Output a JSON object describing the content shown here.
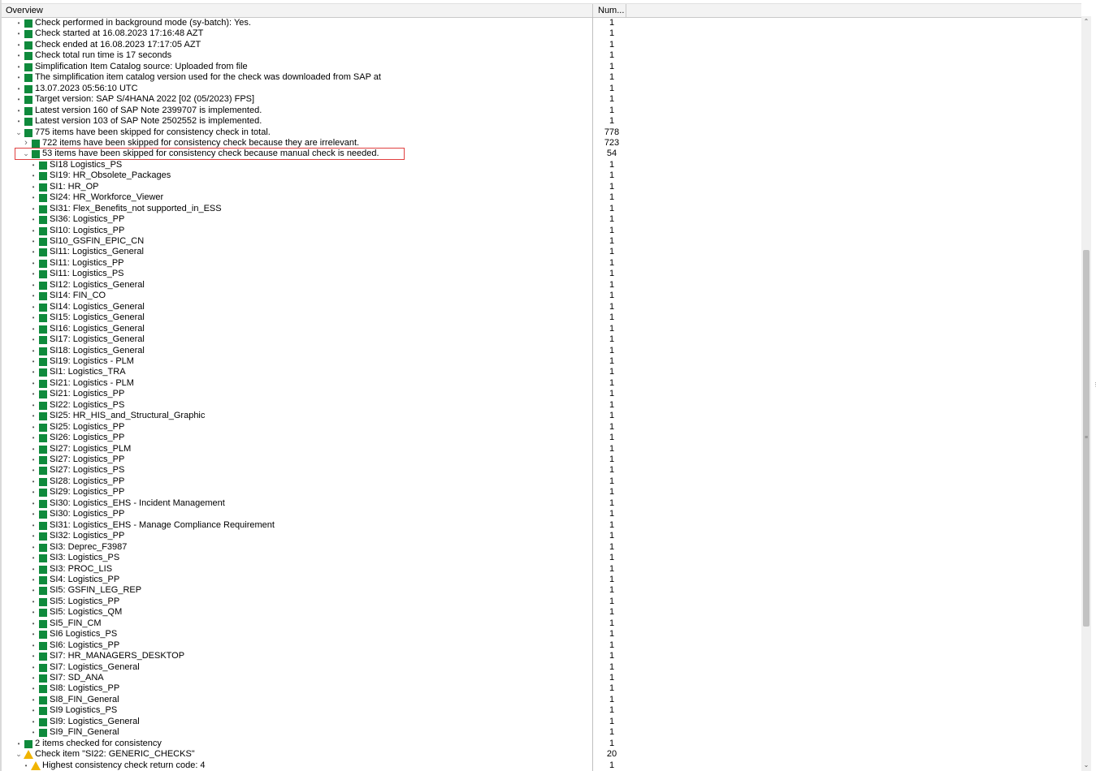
{
  "header": {
    "col_overview": "Overview",
    "col_num": "Num..."
  },
  "colors": {
    "status_ok": "#0f8a3c",
    "status_warning": "#f0b400",
    "highlight_border": "#e04040"
  },
  "rows": [
    {
      "level": 0,
      "toggle": "leaf",
      "icon": "green-square",
      "text": "Check performed in background mode (sy-batch): Yes.",
      "num": "1"
    },
    {
      "level": 0,
      "toggle": "leaf",
      "icon": "green-square",
      "text": "Check started at 16.08.2023 17:16:48 AZT",
      "num": "1"
    },
    {
      "level": 0,
      "toggle": "leaf",
      "icon": "green-square",
      "text": "Check ended at 16.08.2023 17:17:05 AZT",
      "num": "1"
    },
    {
      "level": 0,
      "toggle": "leaf",
      "icon": "green-square",
      "text": "Check total run time is 17  seconds",
      "num": "1"
    },
    {
      "level": 0,
      "toggle": "leaf",
      "icon": "green-square",
      "text": "Simplification Item Catalog source: Uploaded from file",
      "num": "1"
    },
    {
      "level": 0,
      "toggle": "leaf",
      "icon": "green-square",
      "text": "The simplification item catalog version used for the check was downloaded from SAP at",
      "num": "1"
    },
    {
      "level": 0,
      "toggle": "leaf",
      "icon": "green-square",
      "text": "13.07.2023 05:56:10 UTC",
      "num": "1"
    },
    {
      "level": 0,
      "toggle": "leaf",
      "icon": "green-square",
      "text": "Target version: SAP S/4HANA 2022 [02 (05/2023) FPS]",
      "num": "1"
    },
    {
      "level": 0,
      "toggle": "leaf",
      "icon": "green-square",
      "text": "Latest version 160 of SAP Note 2399707 is implemented.",
      "num": "1"
    },
    {
      "level": 0,
      "toggle": "leaf",
      "icon": "green-square",
      "text": "Latest version 103 of SAP Note 2502552 is implemented.",
      "num": "1"
    },
    {
      "level": 0,
      "toggle": "expanded",
      "icon": "green-square",
      "text": "775  items have been skipped for consistency check in total.",
      "num": "778"
    },
    {
      "level": 1,
      "toggle": "collapsed",
      "icon": "green-square",
      "text": "722  items have been skipped for consistency check because they are irrelevant.",
      "num": "723"
    },
    {
      "level": 1,
      "toggle": "expanded",
      "icon": "green-square",
      "text": "53  items have been skipped for consistency check because manual check is needed.",
      "num": "54"
    },
    {
      "level": 2,
      "toggle": "leaf",
      "icon": "green-square",
      "text": "SI18 Logistics_PS",
      "num": "1"
    },
    {
      "level": 2,
      "toggle": "leaf",
      "icon": "green-square",
      "text": "SI19: HR_Obsolete_Packages",
      "num": "1"
    },
    {
      "level": 2,
      "toggle": "leaf",
      "icon": "green-square",
      "text": "SI1: HR_OP",
      "num": "1"
    },
    {
      "level": 2,
      "toggle": "leaf",
      "icon": "green-square",
      "text": "SI24: HR_Workforce_Viewer",
      "num": "1"
    },
    {
      "level": 2,
      "toggle": "leaf",
      "icon": "green-square",
      "text": "SI31: Flex_Benefits_not supported_in_ESS",
      "num": "1"
    },
    {
      "level": 2,
      "toggle": "leaf",
      "icon": "green-square",
      "text": "SI36: Logistics_PP",
      "num": "1"
    },
    {
      "level": 2,
      "toggle": "leaf",
      "icon": "green-square",
      "text": "SI10: Logistics_PP",
      "num": "1"
    },
    {
      "level": 2,
      "toggle": "leaf",
      "icon": "green-square",
      "text": "SI10_GSFIN_EPIC_CN",
      "num": "1"
    },
    {
      "level": 2,
      "toggle": "leaf",
      "icon": "green-square",
      "text": "SI11: Logistics_General",
      "num": "1"
    },
    {
      "level": 2,
      "toggle": "leaf",
      "icon": "green-square",
      "text": "SI11: Logistics_PP",
      "num": "1"
    },
    {
      "level": 2,
      "toggle": "leaf",
      "icon": "green-square",
      "text": "SI11: Logistics_PS",
      "num": "1"
    },
    {
      "level": 2,
      "toggle": "leaf",
      "icon": "green-square",
      "text": "SI12: Logistics_General",
      "num": "1"
    },
    {
      "level": 2,
      "toggle": "leaf",
      "icon": "green-square",
      "text": "SI14: FIN_CO",
      "num": "1"
    },
    {
      "level": 2,
      "toggle": "leaf",
      "icon": "green-square",
      "text": "SI14: Logistics_General",
      "num": "1"
    },
    {
      "level": 2,
      "toggle": "leaf",
      "icon": "green-square",
      "text": "SI15: Logistics_General",
      "num": "1"
    },
    {
      "level": 2,
      "toggle": "leaf",
      "icon": "green-square",
      "text": "SI16: Logistics_General",
      "num": "1"
    },
    {
      "level": 2,
      "toggle": "leaf",
      "icon": "green-square",
      "text": "SI17: Logistics_General",
      "num": "1"
    },
    {
      "level": 2,
      "toggle": "leaf",
      "icon": "green-square",
      "text": "SI18: Logistics_General",
      "num": "1"
    },
    {
      "level": 2,
      "toggle": "leaf",
      "icon": "green-square",
      "text": "SI19: Logistics - PLM",
      "num": "1"
    },
    {
      "level": 2,
      "toggle": "leaf",
      "icon": "green-square",
      "text": "SI1: Logistics_TRA",
      "num": "1"
    },
    {
      "level": 2,
      "toggle": "leaf",
      "icon": "green-square",
      "text": "SI21: Logistics - PLM",
      "num": "1"
    },
    {
      "level": 2,
      "toggle": "leaf",
      "icon": "green-square",
      "text": "SI21: Logistics_PP",
      "num": "1"
    },
    {
      "level": 2,
      "toggle": "leaf",
      "icon": "green-square",
      "text": "SI22: Logistics_PS",
      "num": "1"
    },
    {
      "level": 2,
      "toggle": "leaf",
      "icon": "green-square",
      "text": "SI25: HR_HIS_and_Structural_Graphic",
      "num": "1"
    },
    {
      "level": 2,
      "toggle": "leaf",
      "icon": "green-square",
      "text": "SI25: Logistics_PP",
      "num": "1"
    },
    {
      "level": 2,
      "toggle": "leaf",
      "icon": "green-square",
      "text": "SI26: Logistics_PP",
      "num": "1"
    },
    {
      "level": 2,
      "toggle": "leaf",
      "icon": "green-square",
      "text": "SI27: Logistics_PLM",
      "num": "1"
    },
    {
      "level": 2,
      "toggle": "leaf",
      "icon": "green-square",
      "text": "SI27: Logistics_PP",
      "num": "1"
    },
    {
      "level": 2,
      "toggle": "leaf",
      "icon": "green-square",
      "text": "SI27: Logistics_PS",
      "num": "1"
    },
    {
      "level": 2,
      "toggle": "leaf",
      "icon": "green-square",
      "text": "SI28: Logistics_PP",
      "num": "1"
    },
    {
      "level": 2,
      "toggle": "leaf",
      "icon": "green-square",
      "text": "SI29: Logistics_PP",
      "num": "1"
    },
    {
      "level": 2,
      "toggle": "leaf",
      "icon": "green-square",
      "text": "SI30: Logistics_EHS - Incident Management",
      "num": "1"
    },
    {
      "level": 2,
      "toggle": "leaf",
      "icon": "green-square",
      "text": "SI30: Logistics_PP",
      "num": "1"
    },
    {
      "level": 2,
      "toggle": "leaf",
      "icon": "green-square",
      "text": "SI31: Logistics_EHS - Manage Compliance Requirement",
      "num": "1"
    },
    {
      "level": 2,
      "toggle": "leaf",
      "icon": "green-square",
      "text": "SI32: Logistics_PP",
      "num": "1"
    },
    {
      "level": 2,
      "toggle": "leaf",
      "icon": "green-square",
      "text": "SI3: Deprec_F3987",
      "num": "1"
    },
    {
      "level": 2,
      "toggle": "leaf",
      "icon": "green-square",
      "text": "SI3: Logistics_PS",
      "num": "1"
    },
    {
      "level": 2,
      "toggle": "leaf",
      "icon": "green-square",
      "text": "SI3: PROC_LIS",
      "num": "1"
    },
    {
      "level": 2,
      "toggle": "leaf",
      "icon": "green-square",
      "text": "SI4: Logistics_PP",
      "num": "1"
    },
    {
      "level": 2,
      "toggle": "leaf",
      "icon": "green-square",
      "text": "SI5: GSFIN_LEG_REP",
      "num": "1"
    },
    {
      "level": 2,
      "toggle": "leaf",
      "icon": "green-square",
      "text": "SI5: Logistics_PP",
      "num": "1"
    },
    {
      "level": 2,
      "toggle": "leaf",
      "icon": "green-square",
      "text": "SI5: Logistics_QM",
      "num": "1"
    },
    {
      "level": 2,
      "toggle": "leaf",
      "icon": "green-square",
      "text": "SI5_FIN_CM",
      "num": "1"
    },
    {
      "level": 2,
      "toggle": "leaf",
      "icon": "green-square",
      "text": "SI6 Logistics_PS",
      "num": "1"
    },
    {
      "level": 2,
      "toggle": "leaf",
      "icon": "green-square",
      "text": "SI6: Logistics_PP",
      "num": "1"
    },
    {
      "level": 2,
      "toggle": "leaf",
      "icon": "green-square",
      "text": "SI7: HR_MANAGERS_DESKTOP",
      "num": "1"
    },
    {
      "level": 2,
      "toggle": "leaf",
      "icon": "green-square",
      "text": "SI7: Logistics_General",
      "num": "1"
    },
    {
      "level": 2,
      "toggle": "leaf",
      "icon": "green-square",
      "text": "SI7: SD_ANA",
      "num": "1"
    },
    {
      "level": 2,
      "toggle": "leaf",
      "icon": "green-square",
      "text": "SI8: Logistics_PP",
      "num": "1"
    },
    {
      "level": 2,
      "toggle": "leaf",
      "icon": "green-square",
      "text": "SI8_FIN_General",
      "num": "1"
    },
    {
      "level": 2,
      "toggle": "leaf",
      "icon": "green-square",
      "text": "SI9 Logistics_PS",
      "num": "1"
    },
    {
      "level": 2,
      "toggle": "leaf",
      "icon": "green-square",
      "text": "SI9: Logistics_General",
      "num": "1"
    },
    {
      "level": 2,
      "toggle": "leaf",
      "icon": "green-square",
      "text": "SI9_FIN_General",
      "num": "1"
    },
    {
      "level": 0,
      "toggle": "leaf",
      "icon": "green-square",
      "text": "2  items checked for consistency",
      "num": "1"
    },
    {
      "level": 0,
      "toggle": "expanded",
      "icon": "warning-triangle",
      "text": "Check item \"SI22: GENERIC_CHECKS\"",
      "num": "20"
    },
    {
      "level": 1,
      "toggle": "leaf",
      "icon": "warning-triangle",
      "text": "Highest consistency check return code: 4",
      "num": "1"
    }
  ]
}
